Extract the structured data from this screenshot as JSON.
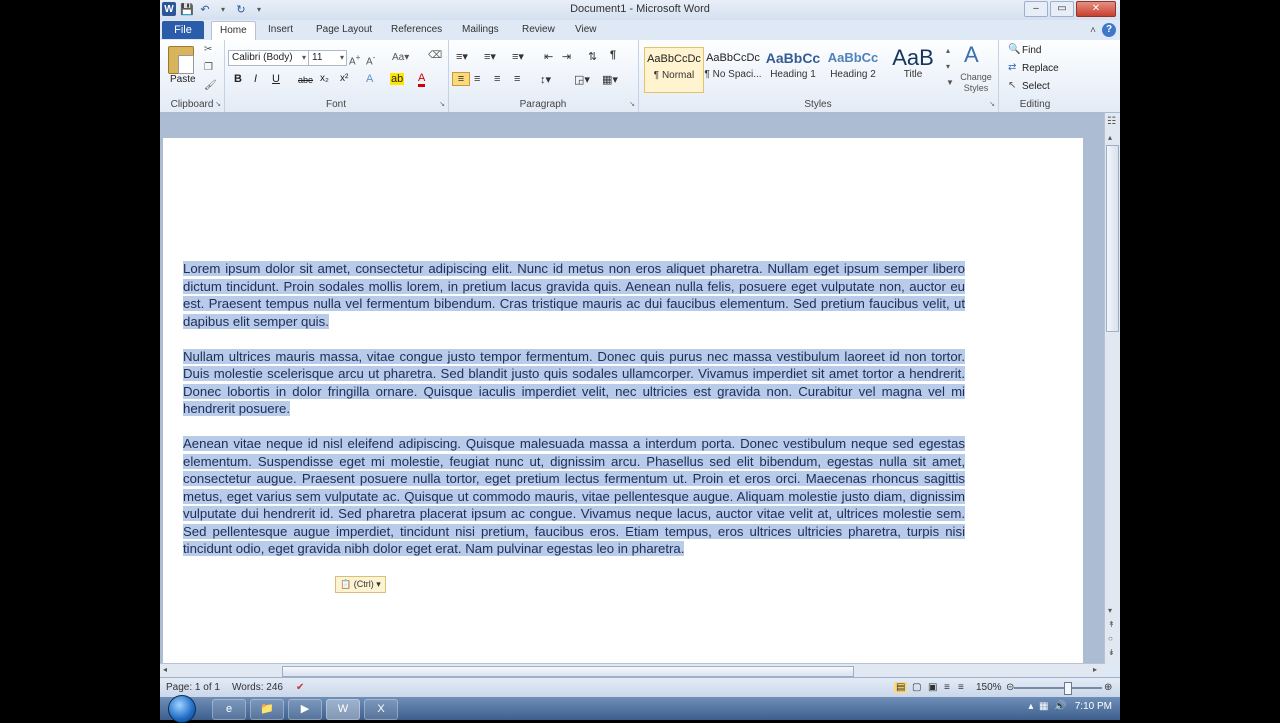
{
  "window": {
    "title": "Document1 - Microsoft Word",
    "qat_icons": [
      "word-logo-icon",
      "save-icon",
      "undo-icon",
      "redo-icon",
      "customize-qat-icon"
    ],
    "min_label": "–",
    "max_label": "▭",
    "close_label": "✕"
  },
  "tabs": {
    "file": "File",
    "items": [
      "Home",
      "Insert",
      "Page Layout",
      "References",
      "Mailings",
      "Review",
      "View"
    ],
    "active": "Home",
    "help_glyph": "?"
  },
  "ribbon": {
    "clipboard": {
      "label": "Clipboard",
      "paste": "Paste"
    },
    "font": {
      "label": "Font",
      "family": "Calibri (Body)",
      "size": "11",
      "buttons": [
        "B",
        "I",
        "U",
        "abe",
        "x₂",
        "x²"
      ]
    },
    "paragraph": {
      "label": "Paragraph"
    },
    "styles": {
      "label": "Styles",
      "items": [
        {
          "preview": "AaBbCcDc",
          "name": "¶ Normal"
        },
        {
          "preview": "AaBbCcDc",
          "name": "¶ No Spaci..."
        },
        {
          "preview": "AaBbCc",
          "name": "Heading 1"
        },
        {
          "preview": "AaBbCc",
          "name": "Heading 2"
        },
        {
          "preview": "AaB",
          "name": "Title"
        }
      ],
      "change_styles": "Change Styles"
    },
    "editing": {
      "label": "Editing",
      "find": "Find",
      "replace": "Replace",
      "select": "Select"
    }
  },
  "document": {
    "paragraphs": [
      "Lorem ipsum dolor sit amet, consectetur adipiscing elit. Nunc id metus non eros aliquet pharetra. Nullam eget ipsum semper libero dictum tincidunt. Proin sodales mollis lorem, in pretium lacus gravida quis. Aenean nulla felis, posuere eget vulputate non, auctor eu est. Praesent tempus nulla vel fermentum bibendum. Cras tristique mauris ac dui faucibus elementum. Sed pretium faucibus velit, ut dapibus elit semper quis.",
      "Nullam ultrices mauris massa, vitae congue justo tempor fermentum. Donec quis purus nec massa vestibulum laoreet id non tortor. Duis molestie scelerisque arcu ut pharetra. Sed blandit justo quis sodales ullamcorper. Vivamus imperdiet sit amet tortor a hendrerit. Donec lobortis in dolor fringilla ornare. Quisque iaculis imperdiet velit, nec ultricies est gravida non. Curabitur vel magna vel mi hendrerit posuere.",
      "Aenean vitae neque id nisl eleifend adipiscing. Quisque malesuada massa a interdum porta. Donec vestibulum neque sed egestas elementum. Suspendisse eget mi molestie, feugiat nunc ut, dignissim arcu. Phasellus sed elit bibendum, egestas nulla sit amet, consectetur augue. Praesent posuere nulla tortor, eget pretium lectus fermentum ut. Proin et eros orci. Maecenas rhoncus sagittis metus, eget varius sem vulputate ac. Quisque ut commodo mauris, vitae pellentesque augue. Aliquam molestie justo diam, dignissim vulputate dui hendrerit id. Sed pharetra placerat ipsum ac congue. Vivamus neque lacus, auctor vitae velit at, ultrices molestie sem. Sed pellentesque augue imperdiet, tincidunt nisi pretium, faucibus eros. Etiam tempus, eros ultrices ultricies pharetra, turpis nisi tincidunt odio, eget gravida nibh dolor eget erat. Nam pulvinar egestas leo in pharetra."
    ],
    "paste_options": "(Ctrl)"
  },
  "status": {
    "page": "Page: 1 of 1",
    "words": "Words: 246",
    "zoom": "150%",
    "zoom_level_fraction": 0.6
  },
  "taskbar": {
    "clock": "7:10 PM"
  }
}
